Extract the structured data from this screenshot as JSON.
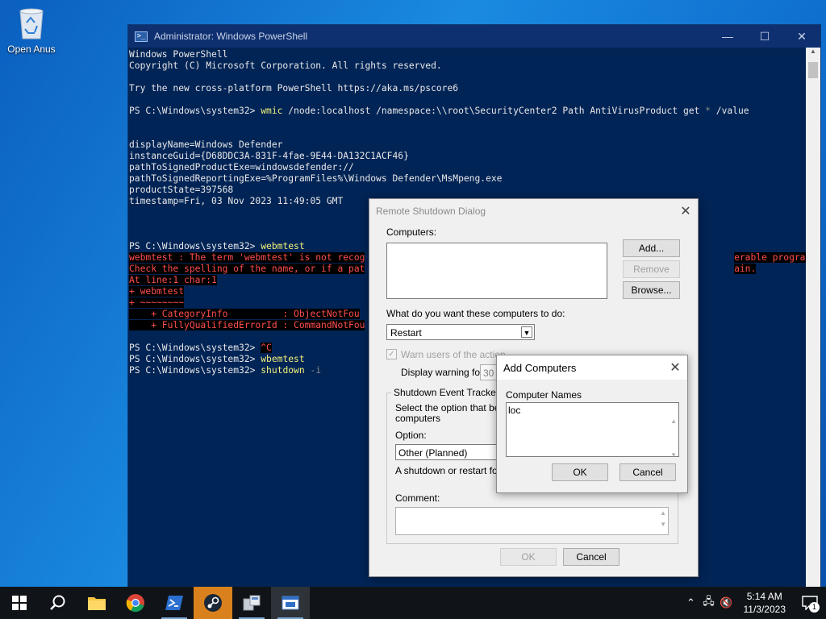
{
  "desktop": {
    "recycle_bin_label": "Open Anus"
  },
  "powershell": {
    "title": "Administrator: Windows PowerShell",
    "lines": [
      {
        "text": "Windows PowerShell"
      },
      {
        "text": "Copyright (C) Microsoft Corporation. All rights reserved."
      },
      {
        "text": ""
      },
      {
        "text": "Try the new cross-platform PowerShell https://aka.ms/pscore6"
      },
      {
        "text": ""
      },
      {
        "prompt": "PS C:\\Windows\\system32> ",
        "cmd": "wmic",
        "args": " /node:localhost /namespace:\\\\root\\SecurityCenter2 Path AntiVirusProduct get ",
        "param": "*",
        "rest": " /value"
      },
      {
        "text": ""
      },
      {
        "text": ""
      },
      {
        "text": "displayName=Windows Defender"
      },
      {
        "text": "instanceGuid={D68DDC3A-831F-4fae-9E44-DA132C1ACF46}"
      },
      {
        "text": "pathToSignedProductExe=windowsdefender://"
      },
      {
        "text": "pathToSignedReportingExe=%ProgramFiles%\\Windows Defender\\MsMpeng.exe"
      },
      {
        "text": "productState=397568"
      },
      {
        "text": "timestamp=Fri, 03 Nov 2023 11:49:05 GMT"
      },
      {
        "text": ""
      },
      {
        "text": ""
      },
      {
        "text": ""
      },
      {
        "prompt": "PS C:\\Windows\\system32> ",
        "cmd": "webmtest",
        "args": "",
        "param": "",
        "rest": ""
      },
      {
        "err": "webmtest : The term 'webmtest' is not recog",
        "err_tail": "erable program."
      },
      {
        "err": "Check the spelling of the name, or if a pat",
        "err_tail": "ain."
      },
      {
        "err": "At line:1 char:1"
      },
      {
        "err": "+ webmtest"
      },
      {
        "err": "+ ~~~~~~~~"
      },
      {
        "err": "    + CategoryInfo          : ObjectNotFou"
      },
      {
        "err": "    + FullyQualifiedErrorId : CommandNotFou"
      },
      {
        "text": ""
      },
      {
        "prompt": "PS C:\\Windows\\system32> ",
        "cmd": "^C",
        "args": "",
        "param": "",
        "rest": "",
        "cmd_err": true
      },
      {
        "prompt": "PS C:\\Windows\\system32> ",
        "cmd": "wbemtest",
        "args": "",
        "param": "",
        "rest": ""
      },
      {
        "prompt": "PS C:\\Windows\\system32> ",
        "cmd": "shutdown",
        "args": " ",
        "param": "-i",
        "rest": ""
      }
    ]
  },
  "remote_shutdown": {
    "title": "Remote Shutdown Dialog",
    "computers_label": "Computers:",
    "add_label": "Add...",
    "remove_label": "Remove",
    "browse_label": "Browse...",
    "action_label": "What do you want these computers to do:",
    "action_value": "Restart",
    "warn_label": "Warn users of the action",
    "display_warning_label": "Display warning for",
    "display_warning_value": "30",
    "tracker_legend": "Shutdown Event Tracker",
    "tracker_desc": "Select the option that best",
    "tracker_desc2": "computers",
    "option_label": "Option:",
    "option_value": "Other (Planned)",
    "shutdown_desc": "A shutdown or restart for ar",
    "comment_label": "Comment:",
    "ok_label": "OK",
    "cancel_label": "Cancel"
  },
  "add_computers": {
    "title": "Add Computers",
    "names_label": "Computer Names",
    "names_value": "loc",
    "ok_label": "OK",
    "cancel_label": "Cancel"
  },
  "taskbar": {
    "items": [
      "start-button",
      "search",
      "file-explorer",
      "chrome",
      "powershell",
      "steam",
      "wmi-tool",
      "remote-shutdown"
    ],
    "time": "5:14 AM",
    "date": "11/3/2023",
    "notification_count": "1"
  }
}
